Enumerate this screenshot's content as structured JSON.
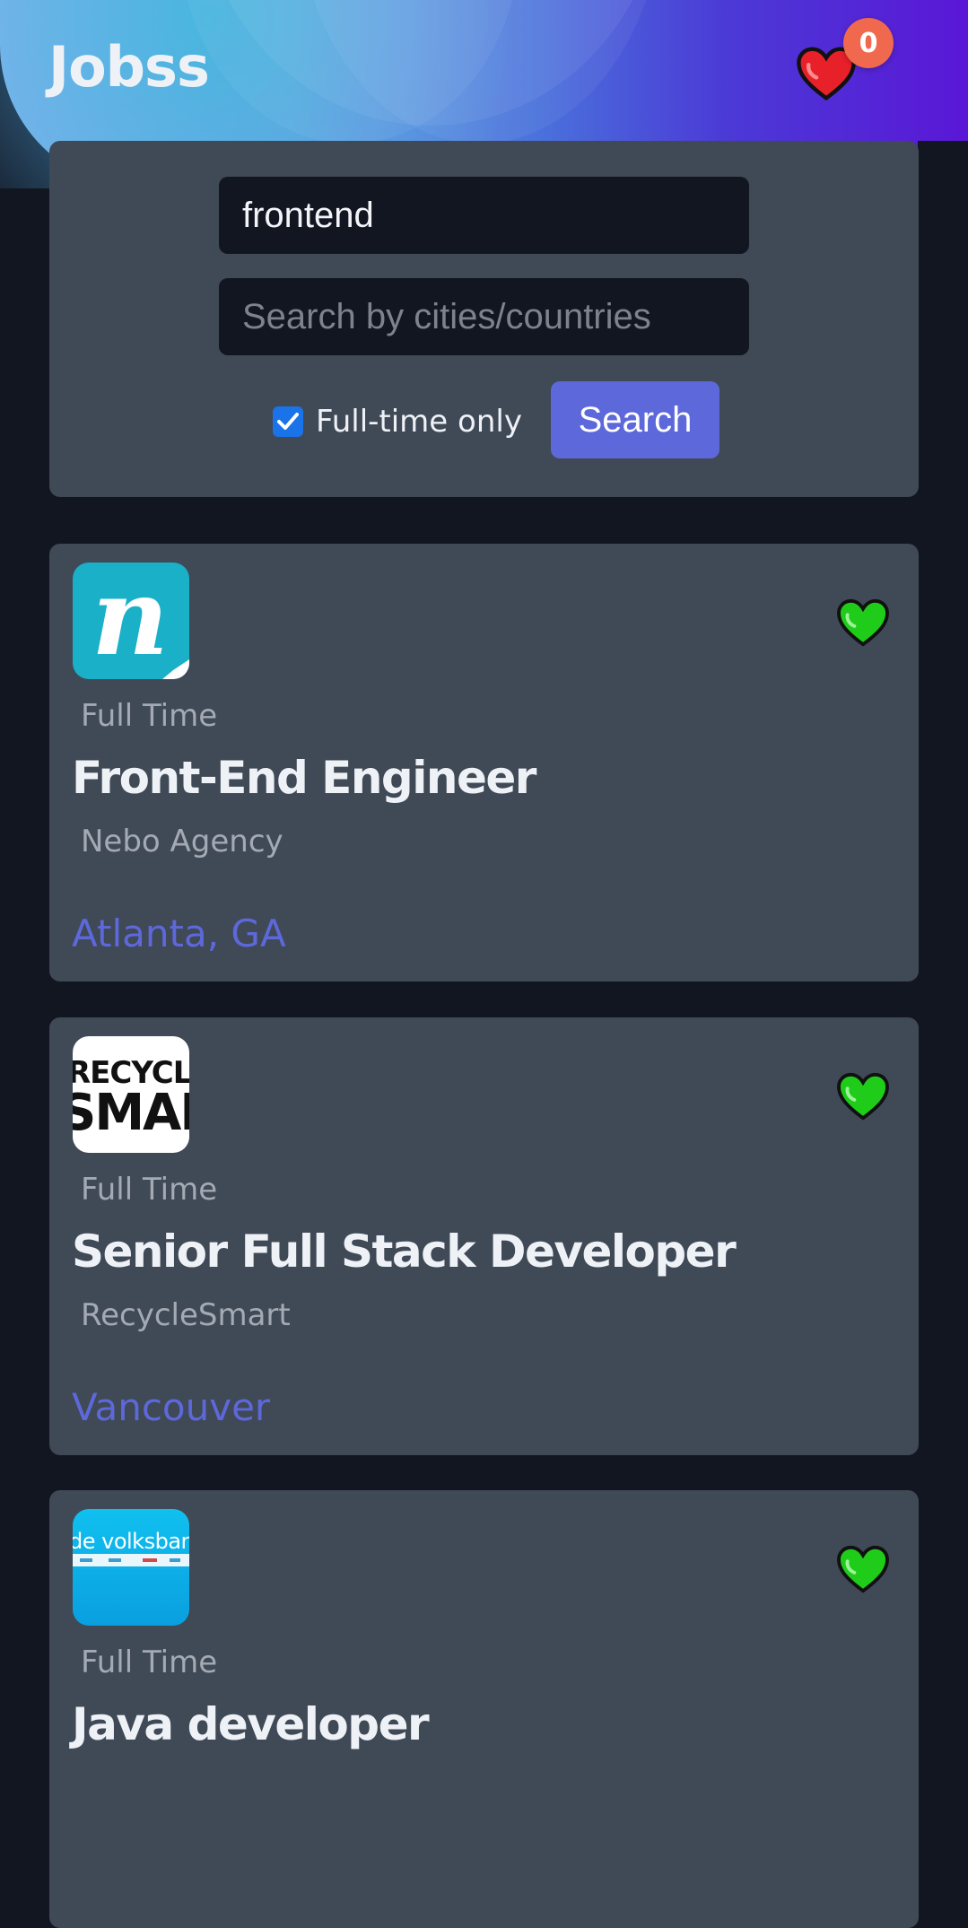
{
  "app": {
    "title": "Jobss"
  },
  "favorites": {
    "count": "0"
  },
  "search": {
    "keyword_value": "frontend",
    "location_placeholder": "Search by cities/countries",
    "fulltime_label": "Full-time only",
    "fulltime_checked": true,
    "button_label": "Search"
  },
  "colors": {
    "accent": "#5d68da",
    "favorite_heart": "#e8202a",
    "card_heart": "#1fcc19",
    "badge": "#f0694f",
    "card_bg": "#404956",
    "page_bg": "#121620"
  },
  "jobs": [
    {
      "type": "Full Time",
      "title": "Front-End Engineer",
      "company": "Nebo Agency",
      "location": "Atlanta, GA",
      "logo_text": "n"
    },
    {
      "type": "Full Time",
      "title": "Senior Full Stack Developer",
      "company": "RecycleSmart",
      "location": "Vancouver",
      "logo_text": "RECYCLE SMART"
    },
    {
      "type": "Full Time",
      "title": "Java developer",
      "company": "",
      "location": "",
      "logo_text": "de volksbank"
    }
  ]
}
